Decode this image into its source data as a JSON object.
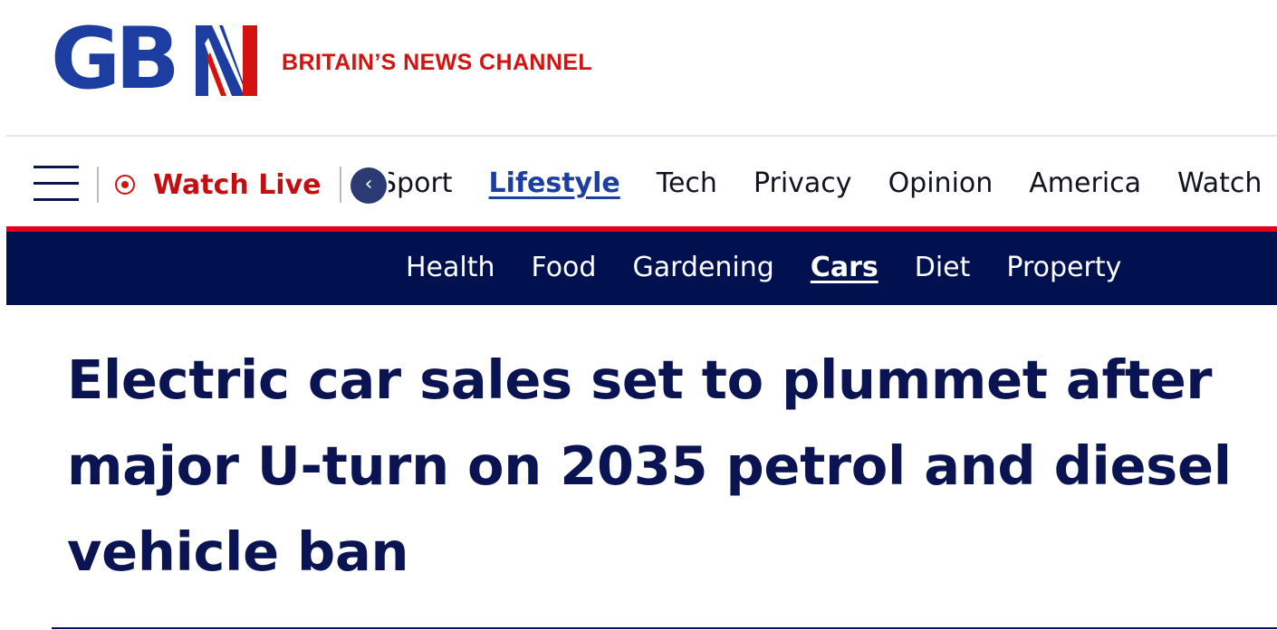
{
  "brand": {
    "logo_text": "GBN",
    "logo_letters": "GB",
    "tagline": "BRITAIN’S NEWS CHANNEL",
    "colors": {
      "navy": "#01114f",
      "blue": "#1b3ea0",
      "red": "#d4120f"
    }
  },
  "nav": {
    "menu_icon": "hamburger-icon",
    "watch_live_label": "Watch Live",
    "live_icon": "live-record-icon",
    "prev_icon": "chevron-left-icon",
    "items": [
      {
        "label": "Sport",
        "active": false
      },
      {
        "label": "Lifestyle",
        "active": true
      },
      {
        "label": "Tech",
        "active": false
      },
      {
        "label": "Privacy",
        "active": false
      },
      {
        "label": "Opinion",
        "active": false
      },
      {
        "label": "America",
        "active": false
      },
      {
        "label": "Watch",
        "active": false
      }
    ]
  },
  "subnav": {
    "items": [
      {
        "label": "Health",
        "active": false
      },
      {
        "label": "Food",
        "active": false
      },
      {
        "label": "Gardening",
        "active": false
      },
      {
        "label": "Cars",
        "active": true
      },
      {
        "label": "Diet",
        "active": false
      },
      {
        "label": "Property",
        "active": false
      }
    ]
  },
  "article": {
    "headline": "Electric car sales set to plummet after major U-turn on 2035 petrol and diesel vehicle ban"
  }
}
